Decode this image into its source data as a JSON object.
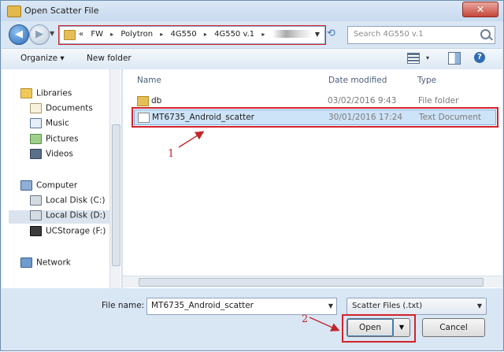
{
  "window": {
    "title": "Open Scatter File",
    "close_glyph": "✕"
  },
  "nav": {
    "back_glyph": "◀",
    "forward_glyph": "▶",
    "history_glyph": "▼",
    "breadcrumbs": [
      "«",
      "FW",
      "Polytron",
      "4G550",
      "4G550 v.1"
    ],
    "crumb_separator": "▸",
    "dropdown_glyph": "▼",
    "refresh_glyph": "⟲",
    "search_placeholder": "Search 4G550 v.1"
  },
  "toolbar": {
    "organize_label": "Organize ▾",
    "new_folder_label": "New folder",
    "views_drop_glyph": "▾",
    "help_glyph": "?"
  },
  "sidebar": {
    "items": [
      {
        "label": "Libraries",
        "icon": "libraries-icon"
      },
      {
        "label": "Documents",
        "icon": "documents-icon"
      },
      {
        "label": "Music",
        "icon": "music-icon"
      },
      {
        "label": "Pictures",
        "icon": "pictures-icon"
      },
      {
        "label": "Videos",
        "icon": "videos-icon"
      },
      {
        "label": "Computer",
        "icon": "computer-icon"
      },
      {
        "label": "Local Disk (C:)",
        "icon": "drive-icon"
      },
      {
        "label": "Local Disk (D:)",
        "icon": "drive-icon"
      },
      {
        "label": "UCStorage (F:)",
        "icon": "drive-icon"
      },
      {
        "label": "Network",
        "icon": "network-icon"
      }
    ]
  },
  "files": {
    "columns": [
      "Name",
      "Date modified",
      "Type"
    ],
    "rows": [
      {
        "name": "db",
        "date": "03/02/2016 9:43",
        "type": "File folder",
        "icon": "folder-icon"
      },
      {
        "name": "MT6735_Android_scatter",
        "date": "30/01/2016 17:24",
        "type": "Text Document",
        "icon": "text-document-icon",
        "selected": true
      }
    ]
  },
  "bottom": {
    "file_name_label": "File name:",
    "file_name_value": "MT6735_Android_scatter",
    "file_type": "Scatter Files (.txt)",
    "open_label": "Open",
    "open_split_glyph": "▼",
    "cancel_label": "Cancel"
  },
  "annotations": {
    "marker_1": "1",
    "marker_2": "2",
    "highlight_color": "#d2232a"
  }
}
